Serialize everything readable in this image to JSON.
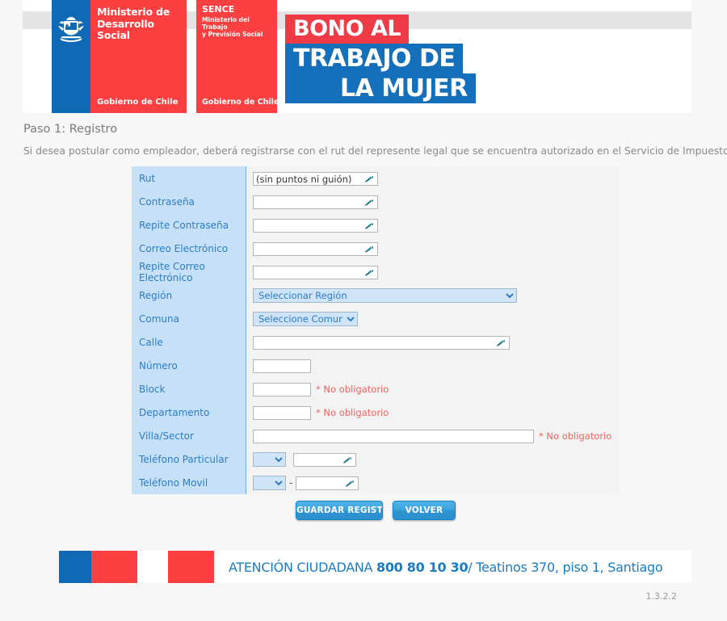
{
  "header": {
    "logo_mds": {
      "title_lines": [
        "Ministerio de",
        "Desarrollo",
        "Social"
      ],
      "government": "Gobierno de Chile",
      "escudo_alt": "escudo-de-chile"
    },
    "logo_sence": {
      "title": "SENCE",
      "subtitle_lines": [
        "Ministerio del Trabajo",
        "y Previsión Social"
      ],
      "government": "Gobierno de Chile"
    },
    "banner": {
      "line1": "BONO AL",
      "line2": "TRABAJO DE",
      "line3": "LA MUJER",
      "red": "#ee3b46",
      "blue": "#1470ba"
    }
  },
  "page": {
    "step_title": "Paso 1: Registro",
    "intro": "Si desea postular como empleador, deberá registrarse con el rut del represente legal que se encuentra autorizado en el Servicio de Impuestos Internos."
  },
  "form": {
    "rows": [
      {
        "label": "Rut",
        "type": "text",
        "value": "(sin puntos ni guión)",
        "placeholder": "",
        "width": "w-rut",
        "optional": ""
      },
      {
        "label": "Contraseña",
        "type": "text",
        "value": "",
        "placeholder": "",
        "width": "w-std",
        "optional": ""
      },
      {
        "label": "Repite Contraseña",
        "type": "text",
        "value": "",
        "placeholder": "",
        "width": "w-std",
        "optional": ""
      },
      {
        "label": "Correo Electrónico",
        "type": "text",
        "value": "",
        "placeholder": "",
        "width": "w-std",
        "optional": ""
      },
      {
        "label": "Repite Correo Electrónico",
        "type": "text",
        "value": "",
        "placeholder": "",
        "width": "w-std",
        "optional": ""
      },
      {
        "label": "Región",
        "type": "select",
        "value": "Seleccionar Región",
        "width": "w-region",
        "optional": ""
      },
      {
        "label": "Comuna",
        "type": "select",
        "value": "Seleccione Comuna",
        "width": "w-comuna",
        "optional": ""
      },
      {
        "label": "Calle",
        "type": "text",
        "value": "",
        "placeholder": "",
        "width": "w-calle",
        "optional": ""
      },
      {
        "label": "Número",
        "type": "plain",
        "value": "",
        "placeholder": "",
        "width": "w-num",
        "optional": ""
      },
      {
        "label": "Block",
        "type": "plain",
        "value": "",
        "placeholder": "",
        "width": "w-block",
        "optional": "* No obligatorio"
      },
      {
        "label": "Departamento",
        "type": "plain",
        "value": "",
        "placeholder": "",
        "width": "w-block",
        "optional": "* No obligatorio"
      },
      {
        "label": "Villa/Sector",
        "type": "plain",
        "value": "",
        "placeholder": "",
        "width": "w-villa",
        "optional": "* No obligatorio"
      },
      {
        "label": "Teléfono Particular",
        "type": "phone",
        "value": "",
        "prefix": "",
        "dash": false,
        "width": "w-tel",
        "optional": ""
      },
      {
        "label": "Teléfono Movil",
        "type": "phone",
        "value": "",
        "prefix": "",
        "dash": true,
        "width": "w-tel",
        "optional": ""
      }
    ],
    "label_bg": "#c6e1f7",
    "label_color": "#2a7cc7",
    "optional_color": "#f0615e",
    "field_icon": "wrench-autofill-icon"
  },
  "buttons": {
    "save": "GUARDAR REGISTRO",
    "back": "VOLVER"
  },
  "footer": {
    "attention_label": "ATENCIÓN CIUDADANA",
    "phone": "800 80 10 30",
    "separator": "/",
    "address": "Teatinos 370, piso 1, Santiago",
    "version": "1.3.2.2",
    "accent_blue": "#1a7dc4"
  }
}
